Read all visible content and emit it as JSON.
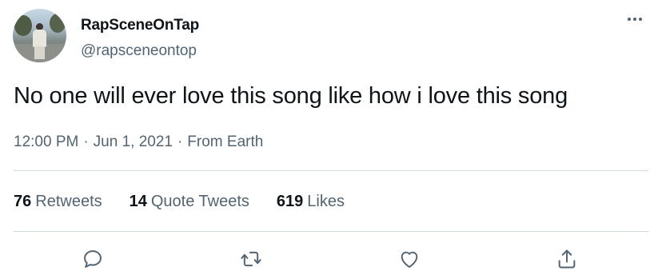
{
  "user": {
    "display_name": "RapSceneOnTap",
    "handle": "@rapsceneontop"
  },
  "tweet": {
    "text": "No one will ever love this song like how i love this song",
    "time": "12:00 PM",
    "separator": "·",
    "date": "Jun 1, 2021",
    "source": "From Earth"
  },
  "stats": [
    {
      "count": "76",
      "label": "Retweets"
    },
    {
      "count": "14",
      "label": "Quote Tweets"
    },
    {
      "count": "619",
      "label": "Likes"
    }
  ],
  "icons": {
    "more": "more-horizontal-icon",
    "reply": "reply-icon",
    "retweet": "retweet-icon",
    "like": "heart-icon",
    "share": "share-icon"
  },
  "colors": {
    "text": "#0f1419",
    "secondary": "#536471",
    "divider": "#cfd9de"
  }
}
